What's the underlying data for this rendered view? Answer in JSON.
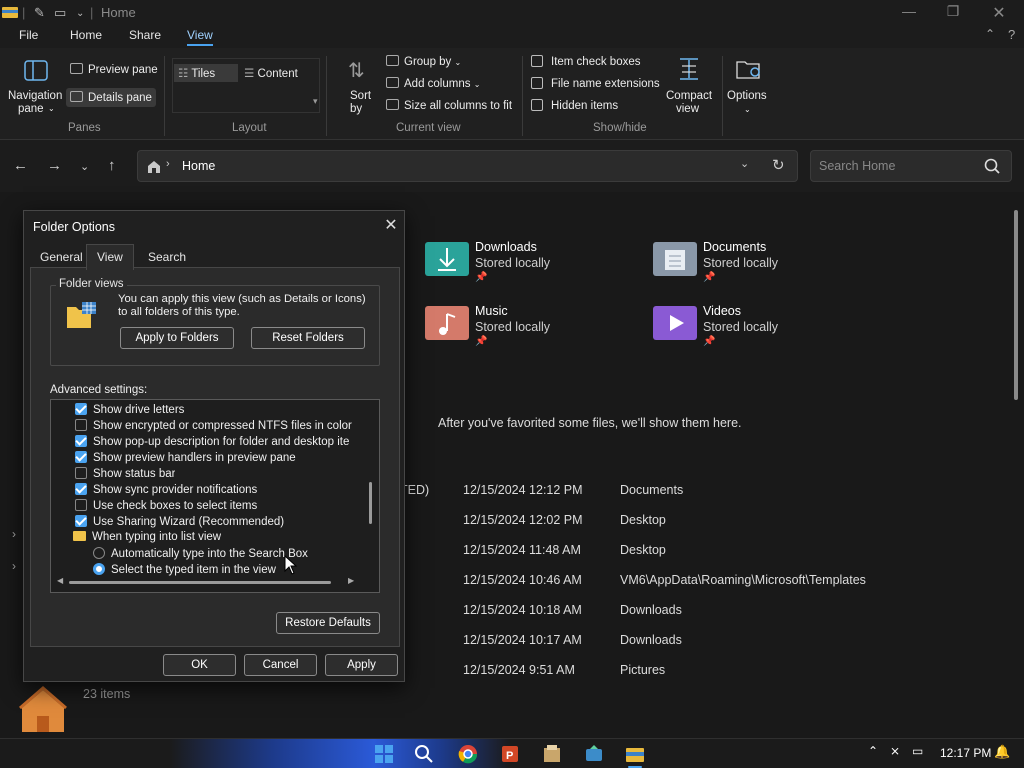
{
  "window": {
    "title": "Home"
  },
  "menu": {
    "tabs": [
      "File",
      "Home",
      "Share",
      "View"
    ]
  },
  "ribbon": {
    "panes": {
      "navigation_pane": "Navigation",
      "navigation_pane_sub": "pane",
      "preview_pane": "Preview pane",
      "details_pane": "Details pane",
      "label": "Panes"
    },
    "layout": {
      "tiles": "Tiles",
      "content": "Content",
      "label": "Layout"
    },
    "current_view": {
      "sort_by": "Sort",
      "sort_by_sub": "by",
      "group_by": "Group by",
      "add_columns": "Add columns",
      "size_columns": "Size all columns to fit",
      "label": "Current view"
    },
    "show_hide": {
      "item_check_boxes": "Item check boxes",
      "file_name_extensions": "File name extensions",
      "hidden_items": "Hidden items",
      "label": "Show/hide"
    },
    "compact_view": "Compact",
    "compact_view_sub": "view",
    "options": "Options"
  },
  "address": {
    "path": "Home",
    "search_placeholder": "Search Home"
  },
  "quick_access": [
    {
      "name": "Downloads",
      "sub": "Stored locally",
      "color": "#2aa39a"
    },
    {
      "name": "Documents",
      "sub": "Stored locally",
      "color": "#8a98a8"
    },
    {
      "name": "Music",
      "sub": "Stored locally",
      "color": "#d47a6a"
    },
    {
      "name": "Videos",
      "sub": "Stored locally",
      "color": "#8a5ad4"
    }
  ],
  "favorites_message": "After you've favorited some files, we'll show them here.",
  "recent": [
    {
      "name_tail": "TED)",
      "date": "12/15/2024 12:12 PM",
      "location": "Documents"
    },
    {
      "name_tail": "",
      "date": "12/15/2024 12:02 PM",
      "location": "Desktop"
    },
    {
      "name_tail": "",
      "date": "12/15/2024 11:48 AM",
      "location": "Desktop"
    },
    {
      "name_tail": "",
      "date": "12/15/2024 10:46 AM",
      "location": "VM6\\AppData\\Roaming\\Microsoft\\Templates"
    },
    {
      "name_tail": "",
      "date": "12/15/2024 10:18 AM",
      "location": "Downloads"
    },
    {
      "name_tail": "",
      "date": "12/15/2024 10:17 AM",
      "location": "Downloads"
    },
    {
      "name_tail": "",
      "date": "12/15/2024 9:51 AM",
      "location": "Pictures"
    }
  ],
  "status": {
    "items": "23 items"
  },
  "taskbar": {
    "time": "12:17 PM"
  },
  "dialog": {
    "title": "Folder Options",
    "tabs": [
      "General",
      "View",
      "Search"
    ],
    "folder_views": {
      "label": "Folder views",
      "description": "You can apply this view (such as Details or Icons) to all folders of this type.",
      "apply_button": "Apply to Folders",
      "reset_button": "Reset Folders"
    },
    "advanced_label": "Advanced settings:",
    "advanced_items": [
      {
        "type": "check",
        "checked": true,
        "label": "Show drive letters"
      },
      {
        "type": "check",
        "checked": false,
        "label": "Show encrypted or compressed NTFS files in color"
      },
      {
        "type": "check",
        "checked": true,
        "label": "Show pop-up description for folder and desktop ite"
      },
      {
        "type": "check",
        "checked": true,
        "label": "Show preview handlers in preview pane"
      },
      {
        "type": "check",
        "checked": false,
        "label": "Show status bar"
      },
      {
        "type": "check",
        "checked": true,
        "label": "Show sync provider notifications"
      },
      {
        "type": "check",
        "checked": false,
        "label": "Use check boxes to select items"
      },
      {
        "type": "check",
        "checked": true,
        "label": "Use Sharing Wizard (Recommended)"
      },
      {
        "type": "folder",
        "label": "When typing into list view"
      },
      {
        "type": "radio",
        "checked": false,
        "label": "Automatically type into the Search Box"
      },
      {
        "type": "radio",
        "checked": true,
        "label": "Select the typed item in the view"
      }
    ],
    "restore_defaults": "Restore Defaults",
    "ok": "OK",
    "cancel": "Cancel",
    "apply": "Apply"
  }
}
